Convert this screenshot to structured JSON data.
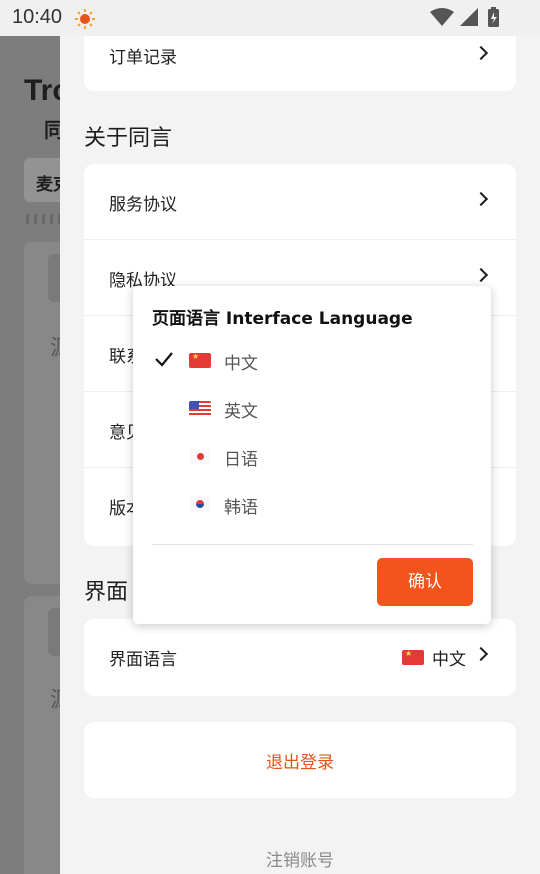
{
  "status_bar": {
    "time": "10:40"
  },
  "background_page": {
    "title_partial": "Tro",
    "subtitle_partial": "同",
    "chip_partial": "麦克",
    "card_glyph_1": "源",
    "card_glyph_2": "源"
  },
  "drawer": {
    "top_card": {
      "order_records": "订单记录"
    },
    "about_section": {
      "title": "关于同言",
      "items": [
        {
          "label": "服务协议"
        },
        {
          "label": "隐私协议"
        },
        {
          "label": "联系"
        },
        {
          "label": "意见"
        },
        {
          "label": "版本"
        }
      ]
    },
    "interface_section": {
      "title": "界面",
      "language_row": {
        "label": "界面语言",
        "value": "中文"
      }
    },
    "logout_label": "退出登录",
    "cancel_account_label": "注销账号"
  },
  "language_popup": {
    "title": "页面语言 Interface Language",
    "options": [
      {
        "label": "中文",
        "flag": "cn-flag-icon",
        "selected": true
      },
      {
        "label": "英文",
        "flag": "us-flag-icon",
        "selected": false
      },
      {
        "label": "日语",
        "flag": "jp-flag-icon",
        "selected": false
      },
      {
        "label": "韩语",
        "flag": "kr-flag-icon",
        "selected": false
      }
    ],
    "confirm_label": "确认"
  },
  "colors": {
    "accent": "#f2541b",
    "logout_text": "#e8531c",
    "background": "#f3f3f3"
  }
}
